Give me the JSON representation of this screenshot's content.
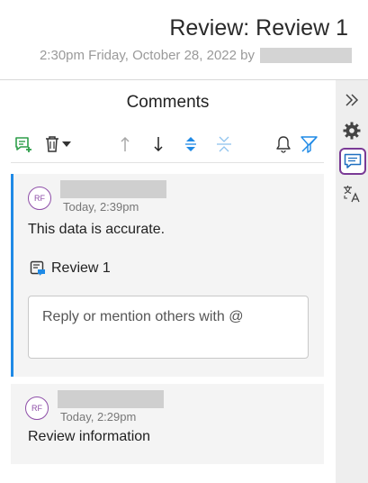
{
  "header": {
    "title": "Review: Review 1",
    "subtitle": "2:30pm Friday, October 28, 2022 by"
  },
  "panel": {
    "title": "Comments"
  },
  "toolbar": {
    "icons": [
      "add-comment-icon",
      "delete-icon",
      "chevron-down-icon",
      "arrow-up-icon",
      "arrow-down-icon",
      "expand-all-icon",
      "collapse-all-icon",
      "bell-icon",
      "filter-icon"
    ]
  },
  "comments": [
    {
      "initials": "RF",
      "time": "Today, 2:39pm",
      "text": "This data is accurate.",
      "reference": "Review 1",
      "reply_placeholder": "Reply or mention others with @"
    },
    {
      "initials": "RF",
      "time": "Today, 2:29pm",
      "text": "Review information"
    }
  ],
  "rightbar": {
    "icons": [
      "double-chevron-right-icon",
      "gear-icon",
      "comments-icon",
      "translate-icon"
    ],
    "active": "comments-icon"
  },
  "colors": {
    "accent_blue": "#1f8ae6",
    "avatar_purple": "#8e4ea8",
    "active_border": "#7a3a96",
    "add_green": "#2e9e4a"
  }
}
